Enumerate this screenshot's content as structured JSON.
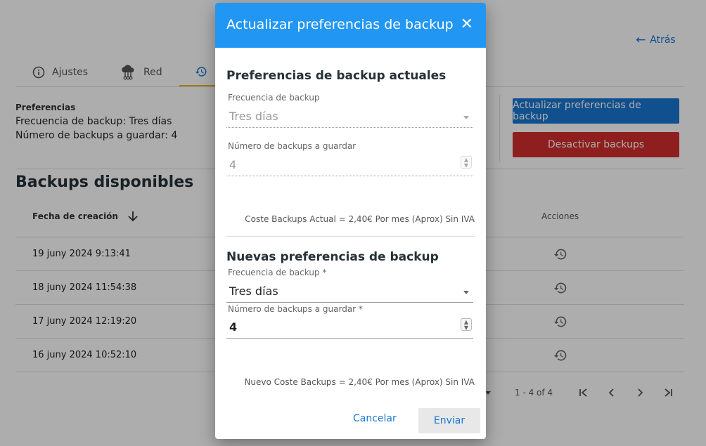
{
  "header": {
    "back_label": "Atrás"
  },
  "tabs": [
    {
      "label": "Ajustes",
      "icon": "info-icon"
    },
    {
      "label": "Red",
      "icon": "cloud-network-icon"
    },
    {
      "label": "",
      "icon": "history-icon"
    }
  ],
  "preferences": {
    "label": "Preferencias",
    "frequency_line": "Frecuencia de backup: Tres días",
    "count_line": "Número de backups a guardar: 4"
  },
  "actions": {
    "update_label": "Actualizar preferencias de backup",
    "deactivate_label": "Desactivar backups"
  },
  "backups": {
    "title": "Backups disponibles",
    "col_date": "Fecha de creación",
    "col_actions": "Acciones",
    "rows": [
      {
        "date": "19 juny 2024 9:13:41"
      },
      {
        "date": "18 juny 2024 11:54:38"
      },
      {
        "date": "17 juny 2024 12:19:20"
      },
      {
        "date": "16 juny 2024 10:52:10"
      }
    ],
    "pagination": {
      "range": "1 - 4 of 4"
    }
  },
  "dialog": {
    "title": "Actualizar preferencias de backup",
    "current": {
      "title": "Preferencias de backup actuales",
      "freq_label": "Frecuencia de backup",
      "freq_value": "Tres días",
      "count_label": "Número de backups a guardar",
      "count_value": "4",
      "cost": "Coste Backups Actual = 2,40€ Por mes (Aprox) Sin IVA"
    },
    "new": {
      "title": "Nuevas preferencias de backup",
      "freq_label": "Frecuencia de backup *",
      "freq_value": "Tres días",
      "count_label": "Número de backups a guardar *",
      "count_value": "4",
      "cost": "Nuevo Coste Backups = 2,40€ Por mes (Aprox) Sin IVA"
    },
    "cancel_label": "Cancelar",
    "send_label": "Enviar"
  },
  "colors": {
    "primary": "#1976d2",
    "dialog_header": "#2196f3",
    "danger": "#d32f2f",
    "active_tab_indicator": "#f0b400"
  }
}
